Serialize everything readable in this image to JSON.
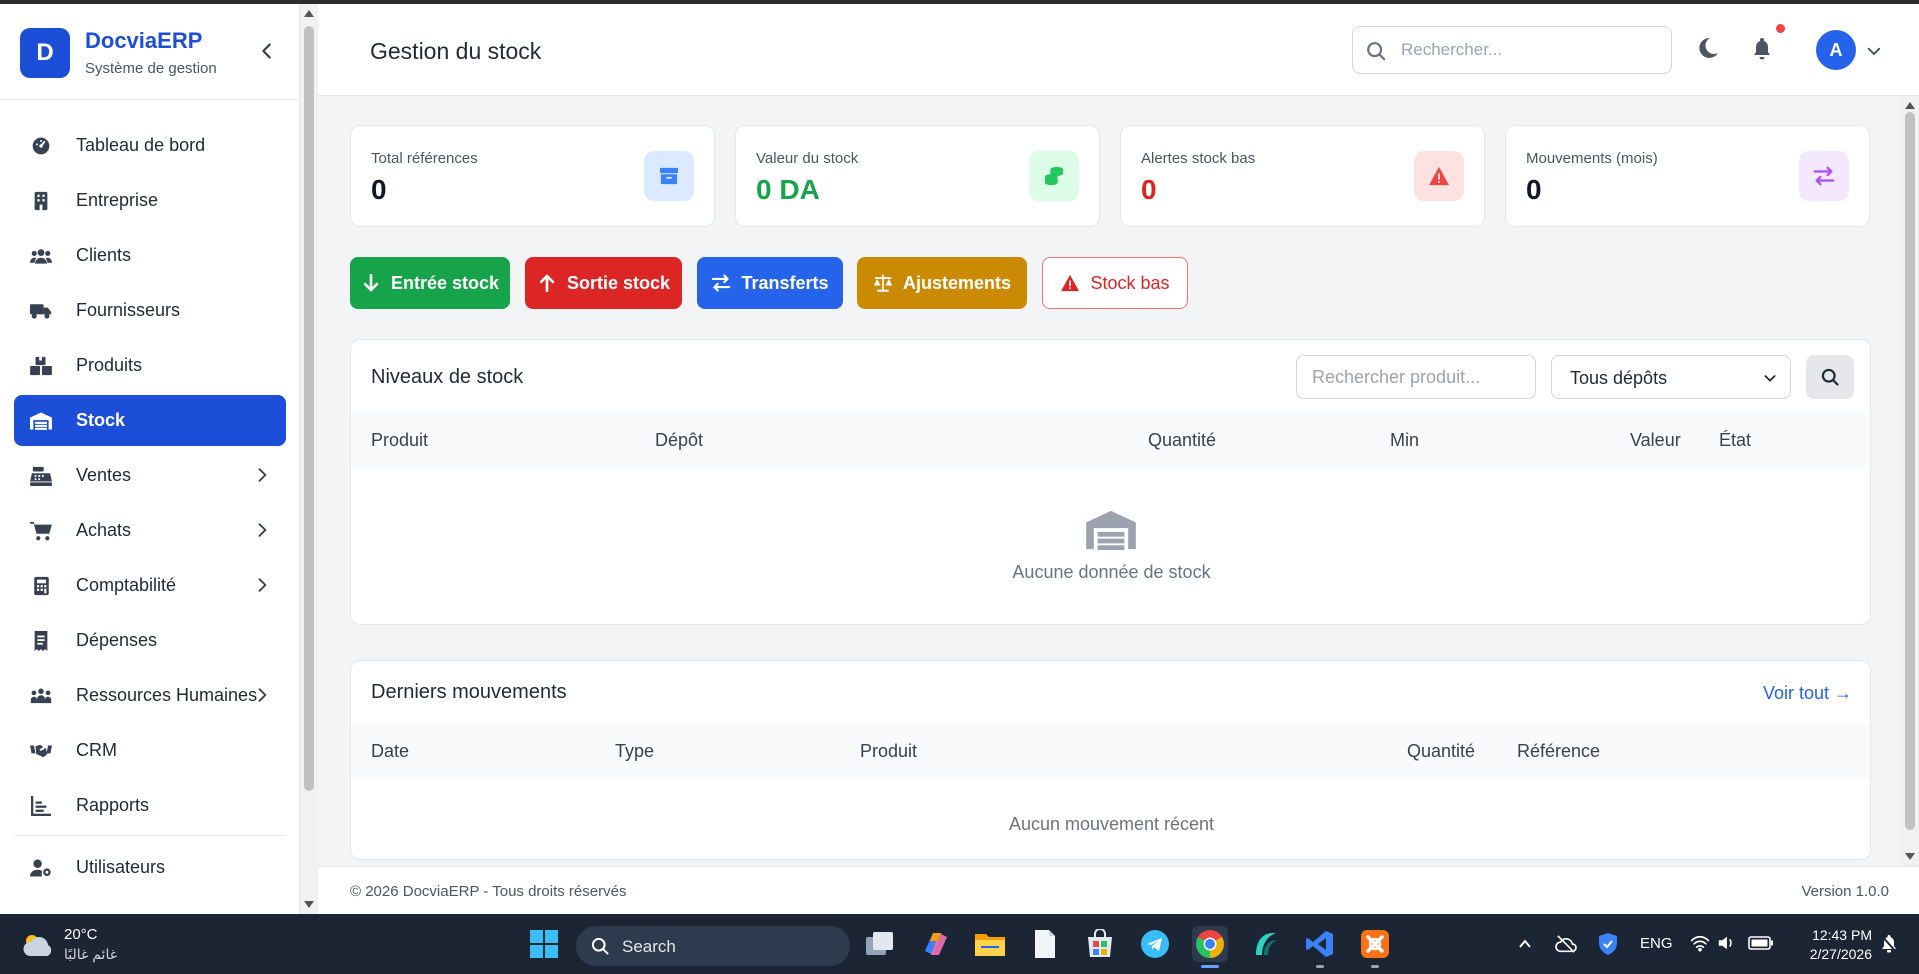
{
  "app": {
    "name": "DocviaERP",
    "subtitle": "Système de gestion",
    "logo_letter": "D"
  },
  "sidebar": {
    "items": [
      {
        "label": "Tableau de bord",
        "icon": "gauge-icon",
        "active": false,
        "has_submenu": false
      },
      {
        "label": "Entreprise",
        "icon": "building-icon",
        "active": false,
        "has_submenu": false
      },
      {
        "label": "Clients",
        "icon": "users-icon",
        "active": false,
        "has_submenu": false
      },
      {
        "label": "Fournisseurs",
        "icon": "truck-icon",
        "active": false,
        "has_submenu": false
      },
      {
        "label": "Produits",
        "icon": "boxes-icon",
        "active": false,
        "has_submenu": false
      },
      {
        "label": "Stock",
        "icon": "warehouse-icon",
        "active": true,
        "has_submenu": false
      },
      {
        "label": "Ventes",
        "icon": "cash-register-icon",
        "active": false,
        "has_submenu": true
      },
      {
        "label": "Achats",
        "icon": "cart-icon",
        "active": false,
        "has_submenu": true
      },
      {
        "label": "Comptabilité",
        "icon": "calculator-icon",
        "active": false,
        "has_submenu": true
      },
      {
        "label": "Dépenses",
        "icon": "receipt-icon",
        "active": false,
        "has_submenu": false
      },
      {
        "label": "Ressources Humaines",
        "icon": "people-group-icon",
        "active": false,
        "has_submenu": true
      },
      {
        "label": "CRM",
        "icon": "handshake-icon",
        "active": false,
        "has_submenu": false
      },
      {
        "label": "Rapports",
        "icon": "chart-icon",
        "active": false,
        "has_submenu": false
      },
      {
        "label": "Utilisateurs",
        "icon": "user-gear-icon",
        "active": false,
        "has_submenu": false
      }
    ]
  },
  "header": {
    "title": "Gestion du stock",
    "search_placeholder": "Rechercher...",
    "avatar_letter": "A"
  },
  "stats": [
    {
      "label": "Total références",
      "value": "0",
      "value_color": "#111827",
      "icon": "box-icon",
      "icon_bg": "#dbeafe",
      "icon_color": "#3b82f6"
    },
    {
      "label": "Valeur du stock",
      "value": "0 DA",
      "value_color": "#16a34a",
      "icon": "coins-icon",
      "icon_bg": "#dcfce7",
      "icon_color": "#22c55e"
    },
    {
      "label": "Alertes stock bas",
      "value": "0",
      "value_color": "#dc2626",
      "icon": "warning-icon",
      "icon_bg": "#fee2e2",
      "icon_color": "#ef4444"
    },
    {
      "label": "Mouvements (mois)",
      "value": "0",
      "value_color": "#111827",
      "icon": "arrows-exchange-icon",
      "icon_bg": "#f3e8ff",
      "icon_color": "#a855f7"
    }
  ],
  "actions": [
    {
      "label": "Entrée stock",
      "icon": "arrow-down-icon",
      "bg": "#16a34a"
    },
    {
      "label": "Sortie stock",
      "icon": "arrow-up-icon",
      "bg": "#dc2626"
    },
    {
      "label": "Transferts",
      "icon": "arrows-exchange-icon",
      "bg": "#2563eb"
    },
    {
      "label": "Ajustements",
      "icon": "scale-icon",
      "bg": "#ca8a04"
    },
    {
      "label": "Stock bas",
      "icon": "warning-icon",
      "bg": "#ffffff",
      "fg": "#dc2626"
    }
  ],
  "stock_levels": {
    "title": "Niveaux de stock",
    "search_placeholder": "Rechercher produit...",
    "depot_selected": "Tous dépôts",
    "columns": [
      "Produit",
      "Dépôt",
      "Quantité",
      "Min",
      "Valeur",
      "État"
    ],
    "rows": [],
    "empty_text": "Aucune donnée de stock"
  },
  "movements": {
    "title": "Derniers mouvements",
    "see_all": "Voir tout →",
    "columns": [
      "Date",
      "Type",
      "Produit",
      "Quantité",
      "Référence"
    ],
    "rows": [],
    "empty_text": "Aucun mouvement récent"
  },
  "footer": {
    "copyright": "© 2026 DocviaERP - Tous droits réservés",
    "version": "Version 1.0.0"
  },
  "taskbar": {
    "weather_temp": "20°C",
    "weather_desc": "غائم غالبًا",
    "search_label": "Search",
    "language": "ENG",
    "time": "12:43 PM",
    "date": "2/27/2026"
  }
}
